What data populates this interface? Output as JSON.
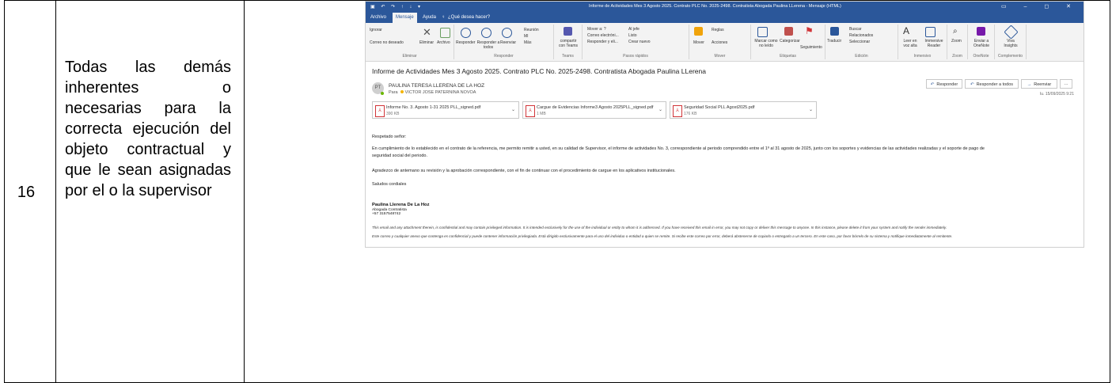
{
  "row": {
    "number": "16",
    "description": "Todas las demás inherentes o necesarias para la correcta ejecución del objeto contractual y que le sean asignadas por el o la supervisor"
  },
  "outlook": {
    "window_title": "Informe de Actividades Mes 3 Agosto 2025. Contrato PLC No. 2025-2498. Contratista Abogada Paulina LLerena  -  Mensaje (HTML)",
    "menu": [
      "Archivo",
      "Mensaje",
      "Ayuda"
    ],
    "menu_active": "Mensaje",
    "tell_me": "¿Qué desea hacer?",
    "ribbon": {
      "eliminar": {
        "ignore": "Ignorar",
        "junk": "Correo no deseado",
        "delete": "Eliminar",
        "archive": "Archivo",
        "group": "Eliminar"
      },
      "responder": {
        "reply": "Responder",
        "reply_all": "Responder a todos",
        "forward": "Reenviar",
        "meeting": "Reunión",
        "im": "MI",
        "more": "Más",
        "group": "Responder"
      },
      "teams": {
        "share": "compartir con Teams",
        "group": "Teams"
      },
      "quick_steps": {
        "items": [
          "Mover a: ?",
          "Correo electróni...",
          "Responder y eli...",
          "Al jefe",
          "Listo",
          "Crear nuevo"
        ],
        "group": "Pasos rápidos"
      },
      "mover": {
        "move": "Mover",
        "rules": "Reglas",
        "actions": "Acciones",
        "group": "Mover"
      },
      "etiquetas": {
        "unread": "Marcar como no leído",
        "categorize": "Categorizar",
        "follow": "Seguimiento",
        "group": "Etiquetas"
      },
      "edicion": {
        "translate": "Traducir",
        "find": "Buscar",
        "related": "Relacionados",
        "select": "Seleccionar",
        "group": "Edición"
      },
      "inmersivo": {
        "read_aloud": "Leer en voz alta",
        "immersive": "Immersive Reader",
        "group": "Inmersivo"
      },
      "zoom": {
        "zoom": "Zoom",
        "group": "Zoom"
      },
      "onenote": {
        "send": "Enviar a OneNote",
        "group": "OneNote"
      },
      "complemento": {
        "viva": "Viva Insights",
        "group": "Complemento"
      }
    },
    "subject": "Informe de Actividades Mes 3 Agosto 2025. Contrato PLC No. 2025-2498. Contratista Abogada Paulina LLerena",
    "sender_initials": "PT",
    "sender": "PAULINA TERESA LLERENA DE LA HOZ",
    "to_label": "Para",
    "to": "VICTOR JOSE PATERNINA NOVOA",
    "actions": {
      "reply": "Responder",
      "reply_all": "Responder a todos",
      "forward": "Reenviar",
      "more": "···"
    },
    "date": "lu. 15/09/2025 9:21",
    "attachments": [
      {
        "name": "Informe No. 3.  Agosto 1-31 2025 PLL_signed.pdf",
        "size": "390 KB"
      },
      {
        "name": "Cargue de Evidencias Informe3 Agosto 2025PLL_signed.pdf",
        "size": "1 MB"
      },
      {
        "name": "Seguridad Social PLL Agost2025.pdf",
        "size": "176 KB"
      }
    ],
    "body": {
      "greeting": "Respetado señor:",
      "p1_line1": "En cumplimiento de lo establecido en el contrato de la referencia, me permito remitir a usted, en su calidad de Supervisor, el informe de actividades No. 3, correspondiente al periodo comprendido entre el 1º al 31 agosto de 2025, junto con los soportes y evidencias de las actividades realizadas y el soporte de pago de",
      "p1_line2": "seguridad social del periodo.",
      "p2": "Agradezco de antemano su revisión y la aprobación correspondiente, con el fin de continuar con el procedimiento de cargue en los aplicativos institucionales.",
      "closing": "Saludos cordiales",
      "sig_name": "Paulina Llerena De La Hoz",
      "sig_title": "Abogada Contratista",
      "sig_phone": "+57 3157548742",
      "disclaimer_en": "This email and any attachment therein, is confidential and may contain privileged information.  It is intended exclusively for the use of the individual or entity to whom it is addressed.  If you have received this email in error, you may not copy or deliver this message to anyone.  In this instance, please delete it from your system and notify the sender immediately.",
      "disclaimer_es": "Este correo y cualquier anexo que contenga es confidencial y puede contener información privilegiada.  Está dirigido exclusivamente para el uso del individuo o entidad a quien se remite.  Si recibe este correo por error, deberá abstenerse de copiarlo o entregarlo a un tercero.  En este caso, por favor bórrelo de su sistema y notifique inmediatamente al remitente."
    }
  }
}
